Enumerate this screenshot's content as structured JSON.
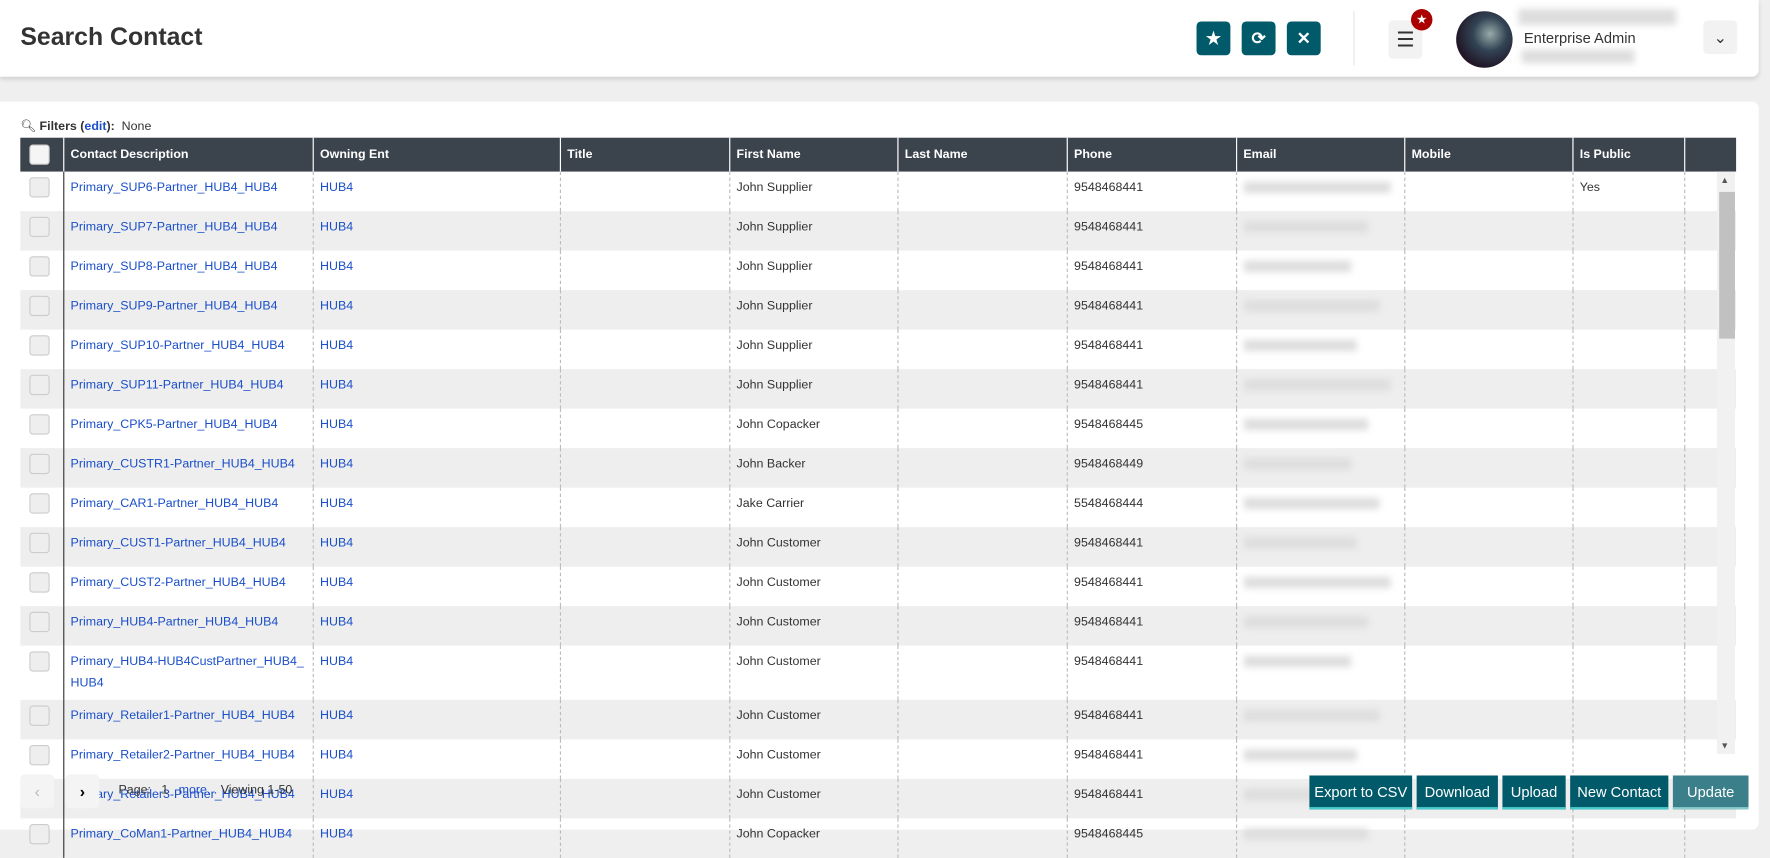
{
  "header": {
    "title": "Search Contact",
    "role": "Enterprise Admin",
    "icons": [
      "star-icon",
      "refresh-icon",
      "close-icon",
      "menu-icon",
      "chevron-down-icon"
    ]
  },
  "filters": {
    "label": "Filters",
    "edit": "edit",
    "value": "None"
  },
  "columns": [
    "Contact Description",
    "Owning Ent",
    "Title",
    "First Name",
    "Last Name",
    "Phone",
    "Email",
    "Mobile",
    "Is Public"
  ],
  "rows": [
    {
      "desc": "Primary_SUP6-Partner_HUB4_HUB4",
      "ent": "HUB4",
      "first": "John Supplier",
      "phone": "9548468441",
      "public": "Yes"
    },
    {
      "desc": "Primary_SUP7-Partner_HUB4_HUB4",
      "ent": "HUB4",
      "first": "John Supplier",
      "phone": "9548468441",
      "public": ""
    },
    {
      "desc": "Primary_SUP8-Partner_HUB4_HUB4",
      "ent": "HUB4",
      "first": "John Supplier",
      "phone": "9548468441",
      "public": ""
    },
    {
      "desc": "Primary_SUP9-Partner_HUB4_HUB4",
      "ent": "HUB4",
      "first": "John Supplier",
      "phone": "9548468441",
      "public": ""
    },
    {
      "desc": "Primary_SUP10-Partner_HUB4_HUB4",
      "ent": "HUB4",
      "first": "John Supplier",
      "phone": "9548468441",
      "public": ""
    },
    {
      "desc": "Primary_SUP11-Partner_HUB4_HUB4",
      "ent": "HUB4",
      "first": "John Supplier",
      "phone": "9548468441",
      "public": ""
    },
    {
      "desc": "Primary_CPK5-Partner_HUB4_HUB4",
      "ent": "HUB4",
      "first": "John Copacker",
      "phone": "9548468445",
      "public": ""
    },
    {
      "desc": "Primary_CUSTR1-Partner_HUB4_HUB4",
      "ent": "HUB4",
      "first": "John Backer",
      "phone": "9548468449",
      "public": ""
    },
    {
      "desc": "Primary_CAR1-Partner_HUB4_HUB4",
      "ent": "HUB4",
      "first": "Jake Carrier",
      "phone": "5548468444",
      "public": ""
    },
    {
      "desc": "Primary_CUST1-Partner_HUB4_HUB4",
      "ent": "HUB4",
      "first": "John Customer",
      "phone": "9548468441",
      "public": ""
    },
    {
      "desc": "Primary_CUST2-Partner_HUB4_HUB4",
      "ent": "HUB4",
      "first": "John Customer",
      "phone": "9548468441",
      "public": ""
    },
    {
      "desc": "Primary_HUB4-Partner_HUB4_HUB4",
      "ent": "HUB4",
      "first": "John Customer",
      "phone": "9548468441",
      "public": ""
    },
    {
      "desc": "Primary_HUB4-HUB4CustPartner_HUB4_HUB4",
      "ent": "HUB4",
      "first": "John Customer",
      "phone": "9548468441",
      "public": ""
    },
    {
      "desc": "Primary_Retailer1-Partner_HUB4_HUB4",
      "ent": "HUB4",
      "first": "John Customer",
      "phone": "9548468441",
      "public": ""
    },
    {
      "desc": "Primary_Retailer2-Partner_HUB4_HUB4",
      "ent": "HUB4",
      "first": "John Customer",
      "phone": "9548468441",
      "public": ""
    },
    {
      "desc": "Primary_Retailer3-Partner_HUB4_HUB4",
      "ent": "HUB4",
      "first": "John Customer",
      "phone": "9548468441",
      "public": ""
    },
    {
      "desc": "Primary_CoMan1-Partner_HUB4_HUB4",
      "ent": "HUB4",
      "first": "John Copacker",
      "phone": "9548468445",
      "public": ""
    }
  ],
  "pager": {
    "page_label": "Page:",
    "page": "1",
    "more": "more...",
    "viewing": "Viewing 1-50"
  },
  "actions": {
    "export": "Export to CSV",
    "download": "Download",
    "upload": "Upload",
    "new_contact": "New Contact",
    "update": "Update"
  },
  "colors": {
    "accent": "#005a6a",
    "header_bg": "#3b434d",
    "link": "#1a4fc9",
    "badge": "#aa0000"
  }
}
